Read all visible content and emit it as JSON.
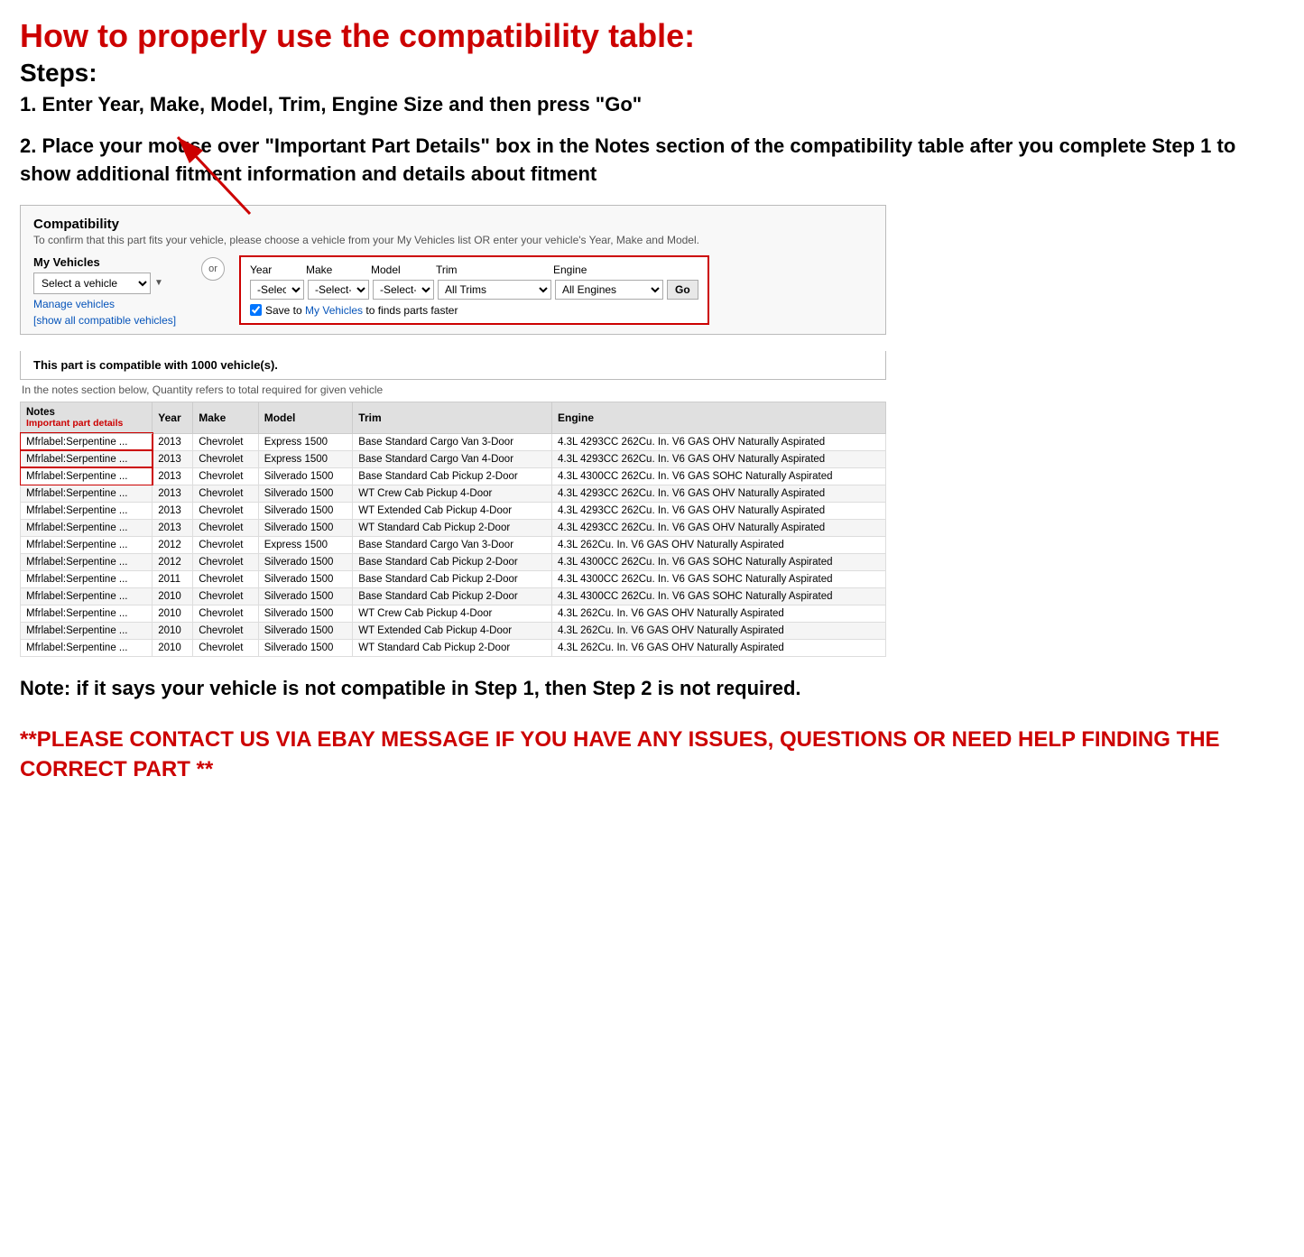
{
  "page": {
    "main_title": "How to properly use the compatibility table:",
    "steps_heading": "Steps:",
    "step1": "1. Enter Year, Make, Model, Trim, Engine Size and then press \"Go\"",
    "step2": "2. Place your mouse over \"Important Part Details\" box in the Notes section of the compatibility table after you complete Step 1 to show additional fitment information and details about fitment",
    "note": "Note: if it says your vehicle is not compatible in Step 1, then Step 2 is not required.",
    "contact": "**PLEASE CONTACT US VIA EBAY MESSAGE IF YOU HAVE ANY ISSUES, QUESTIONS OR NEED HELP FINDING THE CORRECT PART **"
  },
  "compatibility_widget": {
    "title": "Compatibility",
    "subtitle": "To confirm that this part fits your vehicle, please choose a vehicle from your My Vehicles list OR enter your vehicle's Year, Make and Model.",
    "my_vehicles_label": "My Vehicles",
    "select_vehicle_placeholder": "Select a vehicle",
    "manage_vehicles": "Manage vehicles",
    "show_all": "[show all compatible vehicles]",
    "or_label": "or",
    "year_label": "Year",
    "make_label": "Make",
    "model_label": "Model",
    "trim_label": "Trim",
    "engine_label": "Engine",
    "year_value": "-Select-",
    "make_value": "-Select-",
    "model_value": "-Select-",
    "trim_value": "All Trims",
    "engine_value": "All Engines",
    "go_label": "Go",
    "save_label": "Save to My Vehicles to finds parts faster",
    "compatible_count": "This part is compatible with 1000 vehicle(s).",
    "quantity_note": "In the notes section below, Quantity refers to total required for given vehicle"
  },
  "table": {
    "headers": [
      "Notes",
      "Year",
      "Make",
      "Model",
      "Trim",
      "Engine"
    ],
    "notes_sub": "Important part details",
    "rows": [
      {
        "notes": "Mfrlabel:Serpentine ...",
        "year": "2013",
        "make": "Chevrolet",
        "model": "Express 1500",
        "trim": "Base Standard Cargo Van 3-Door",
        "engine": "4.3L 4293CC 262Cu. In. V6 GAS OHV Naturally Aspirated"
      },
      {
        "notes": "Mfrlabel:Serpentine ...",
        "year": "2013",
        "make": "Chevrolet",
        "model": "Express 1500",
        "trim": "Base Standard Cargo Van 4-Door",
        "engine": "4.3L 4293CC 262Cu. In. V6 GAS OHV Naturally Aspirated"
      },
      {
        "notes": "Mfrlabel:Serpentine ...",
        "year": "2013",
        "make": "Chevrolet",
        "model": "Silverado 1500",
        "trim": "Base Standard Cab Pickup 2-Door",
        "engine": "4.3L 4300CC 262Cu. In. V6 GAS SOHC Naturally Aspirated"
      },
      {
        "notes": "Mfrlabel:Serpentine ...",
        "year": "2013",
        "make": "Chevrolet",
        "model": "Silverado 1500",
        "trim": "WT Crew Cab Pickup 4-Door",
        "engine": "4.3L 4293CC 262Cu. In. V6 GAS OHV Naturally Aspirated"
      },
      {
        "notes": "Mfrlabel:Serpentine ...",
        "year": "2013",
        "make": "Chevrolet",
        "model": "Silverado 1500",
        "trim": "WT Extended Cab Pickup 4-Door",
        "engine": "4.3L 4293CC 262Cu. In. V6 GAS OHV Naturally Aspirated"
      },
      {
        "notes": "Mfrlabel:Serpentine ...",
        "year": "2013",
        "make": "Chevrolet",
        "model": "Silverado 1500",
        "trim": "WT Standard Cab Pickup 2-Door",
        "engine": "4.3L 4293CC 262Cu. In. V6 GAS OHV Naturally Aspirated"
      },
      {
        "notes": "Mfrlabel:Serpentine ...",
        "year": "2012",
        "make": "Chevrolet",
        "model": "Express 1500",
        "trim": "Base Standard Cargo Van 3-Door",
        "engine": "4.3L 262Cu. In. V6 GAS OHV Naturally Aspirated"
      },
      {
        "notes": "Mfrlabel:Serpentine ...",
        "year": "2012",
        "make": "Chevrolet",
        "model": "Silverado 1500",
        "trim": "Base Standard Cab Pickup 2-Door",
        "engine": "4.3L 4300CC 262Cu. In. V6 GAS SOHC Naturally Aspirated"
      },
      {
        "notes": "Mfrlabel:Serpentine ...",
        "year": "2011",
        "make": "Chevrolet",
        "model": "Silverado 1500",
        "trim": "Base Standard Cab Pickup 2-Door",
        "engine": "4.3L 4300CC 262Cu. In. V6 GAS SOHC Naturally Aspirated"
      },
      {
        "notes": "Mfrlabel:Serpentine ...",
        "year": "2010",
        "make": "Chevrolet",
        "model": "Silverado 1500",
        "trim": "Base Standard Cab Pickup 2-Door",
        "engine": "4.3L 4300CC 262Cu. In. V6 GAS SOHC Naturally Aspirated"
      },
      {
        "notes": "Mfrlabel:Serpentine ...",
        "year": "2010",
        "make": "Chevrolet",
        "model": "Silverado 1500",
        "trim": "WT Crew Cab Pickup 4-Door",
        "engine": "4.3L 262Cu. In. V6 GAS OHV Naturally Aspirated"
      },
      {
        "notes": "Mfrlabel:Serpentine ...",
        "year": "2010",
        "make": "Chevrolet",
        "model": "Silverado 1500",
        "trim": "WT Extended Cab Pickup 4-Door",
        "engine": "4.3L 262Cu. In. V6 GAS OHV Naturally Aspirated"
      },
      {
        "notes": "Mfrlabel:Serpentine ...",
        "year": "2010",
        "make": "Chevrolet",
        "model": "Silverado 1500",
        "trim": "WT Standard Cab Pickup 2-Door",
        "engine": "4.3L 262Cu. In. V6 GAS OHV Naturally Aspirated"
      }
    ]
  }
}
